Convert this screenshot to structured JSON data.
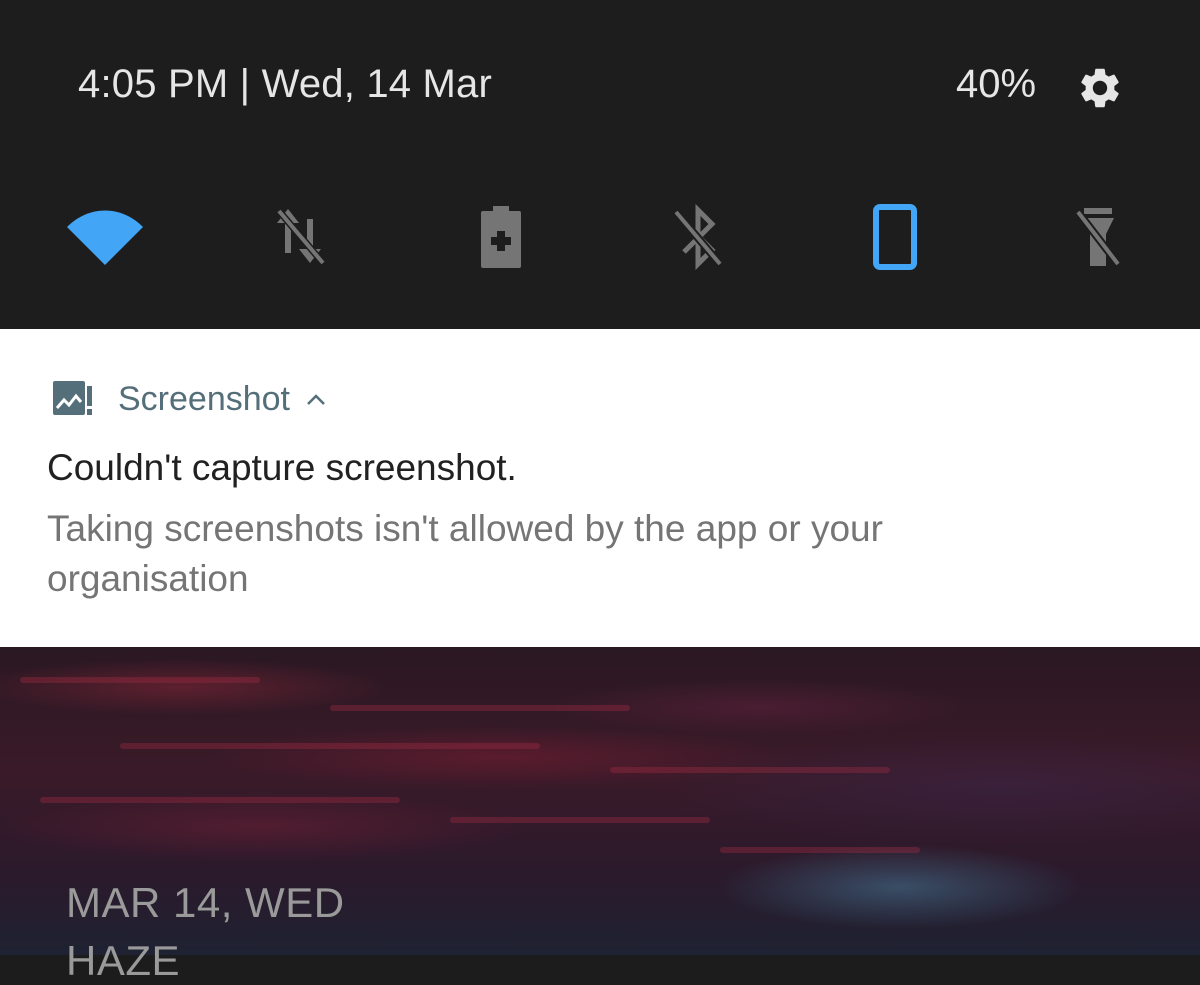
{
  "status_bar": {
    "datetime": "4:05 PM | Wed, 14 Mar",
    "battery_percent": "40%",
    "settings_icon": "gear-icon"
  },
  "quick_settings": {
    "tiles": [
      {
        "name": "wifi",
        "icon": "wifi-icon",
        "active": true
      },
      {
        "name": "data",
        "icon": "mobile-data-off-icon",
        "active": false
      },
      {
        "name": "battery-saver",
        "icon": "battery-saver-icon",
        "active": false
      },
      {
        "name": "bluetooth",
        "icon": "bluetooth-off-icon",
        "active": false
      },
      {
        "name": "auto-rotate",
        "icon": "portrait-rotate-icon",
        "active": true
      },
      {
        "name": "flashlight",
        "icon": "flashlight-off-icon",
        "active": false
      }
    ],
    "colors": {
      "active": "#42a5f5",
      "inactive": "#757575",
      "panel_bg": "#1d1d1d"
    }
  },
  "notification": {
    "app_name": "Screenshot",
    "app_icon": "screenshot-error-icon",
    "title": "Couldn't capture screenshot.",
    "body": "Taking screenshots isn't allowed by the app or your organisation",
    "colors": {
      "app_name": "#546e7a",
      "title": "#212121",
      "body": "#757575"
    }
  },
  "lockscreen": {
    "date": "MAR 14, WED",
    "weather": "HAZE"
  }
}
